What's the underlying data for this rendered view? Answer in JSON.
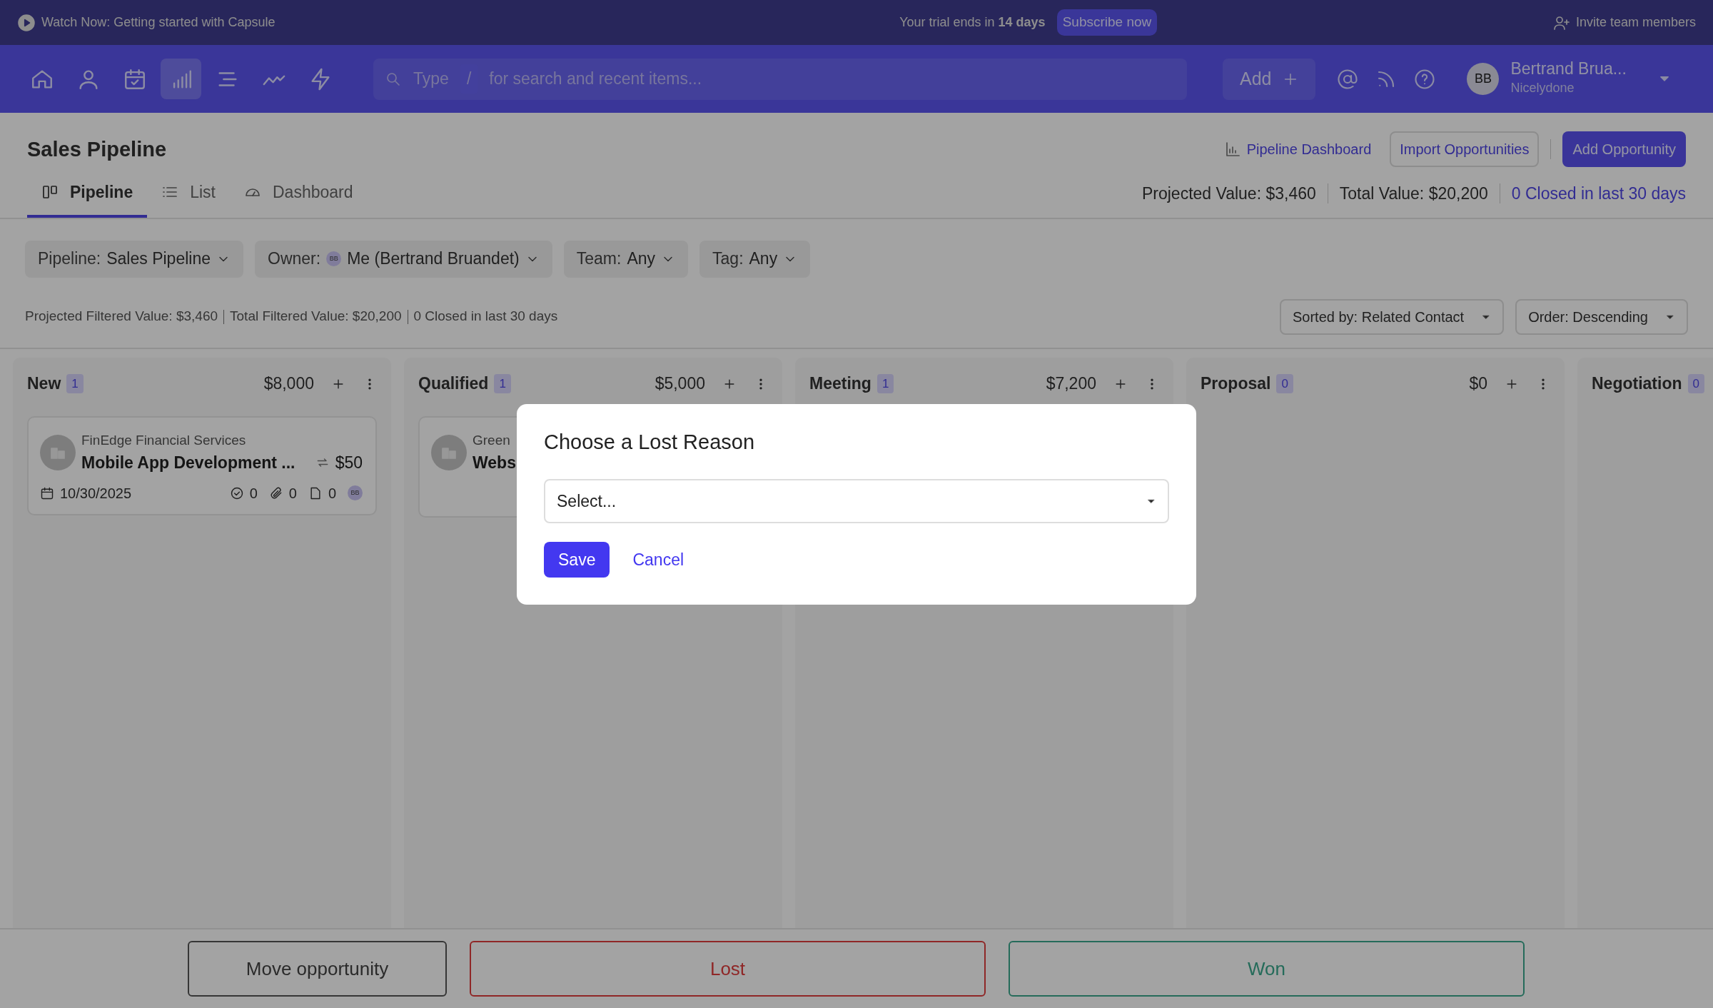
{
  "promo_bar": {
    "watch_link": "Watch Now: Getting started with Capsule",
    "trial_text": "Your trial ends in **14 days**",
    "subscribe_button": "Subscribe now",
    "invite_link": "Invite team members"
  },
  "nav": {
    "icons": [
      {
        "kind": "home",
        "selected": false
      },
      {
        "kind": "person",
        "selected": false
      },
      {
        "kind": "calendar",
        "selected": false
      },
      {
        "kind": "chart",
        "selected": true
      },
      {
        "kind": "lines",
        "selected": false
      },
      {
        "kind": "trend",
        "selected": false
      },
      {
        "kind": "bolt",
        "selected": false
      }
    ],
    "search": {
      "placeholder_start": "Type",
      "key": "/",
      "placeholder_end": "for search and recent items..."
    },
    "add_button": "Add",
    "user": {
      "initials": "BB",
      "name": "Bertrand Brua...",
      "account": "Nicelydone"
    }
  },
  "page": {
    "title": "Sales Pipeline",
    "dashboard_link": "Pipeline Dashboard",
    "import_button": "Import Opportunities",
    "add_button": "Add Opportunity",
    "tabs": [
      {
        "label": "Pipeline",
        "kind": "board",
        "selected": true
      },
      {
        "label": "List",
        "kind": "list",
        "selected": false
      },
      {
        "label": "Dashboard",
        "kind": "gauge",
        "selected": false
      }
    ],
    "summary": [
      {
        "text": "Projected Value: $3,460",
        "kind": "plain"
      },
      {
        "text": "Total Value: $20,200",
        "kind": "plain"
      },
      {
        "text": "0 Closed in last 30 days",
        "kind": "link"
      }
    ]
  },
  "filters": [
    {
      "label": "Pipeline:",
      "value": "Sales Pipeline"
    },
    {
      "label": "Owner:",
      "avatar": "BB",
      "value": "Me (Bertrand Bruandet)"
    },
    {
      "label": "Team:",
      "value": "Any"
    },
    {
      "label": "Tag:",
      "value": "Any"
    }
  ],
  "filtered_summary": [
    "Projected Filtered Value: $3,460",
    "Total Filtered Value: $20,200",
    "0 Closed in last 30 days"
  ],
  "sort": [
    "Sorted by: Related Contact",
    "Order: Descending"
  ],
  "columns": [
    {
      "name": "New",
      "count": "1",
      "total": "$8,000",
      "cards": [
        {
          "company": "FinEdge Financial Services",
          "title": "Mobile App Development ...",
          "recurring": true,
          "amount": "$50",
          "date": "10/30/2025",
          "tasks": "0",
          "files": "0",
          "notes": "0",
          "owner": "BB"
        }
      ]
    },
    {
      "name": "Qualified",
      "count": "1",
      "total": "$5,000",
      "cards": [
        {
          "company": "Green",
          "title": "Webs"
        }
      ]
    },
    {
      "name": "Meeting",
      "count": "1",
      "total": "$7,200"
    },
    {
      "name": "Proposal",
      "count": "0",
      "total": "$0"
    },
    {
      "name": "Negotiation",
      "count": "0"
    }
  ],
  "bottom_actions": [
    {
      "label": "Move opportunity",
      "kind": "neutral"
    },
    {
      "label": "Lost",
      "kind": "lost"
    },
    {
      "label": "Won",
      "kind": "won"
    }
  ],
  "dialog": {
    "title": "Choose a Lost Reason",
    "select_value": "Select...",
    "save_button": "Save",
    "cancel_button": "Cancel"
  }
}
